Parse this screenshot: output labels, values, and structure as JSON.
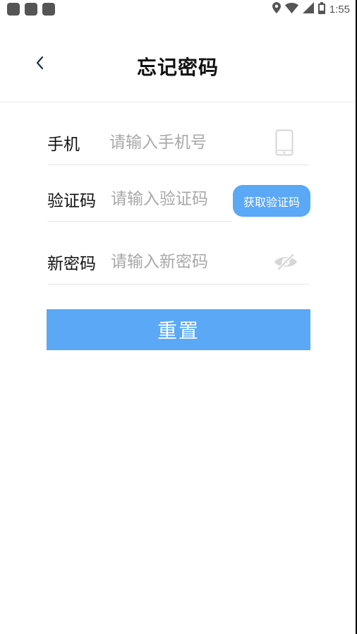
{
  "status_bar": {
    "time": "1:55",
    "icons": [
      "notification-icon",
      "notification-icon",
      "notification-icon",
      "location-icon",
      "wifi-icon",
      "signal-icon",
      "battery-icon"
    ]
  },
  "header": {
    "title": "忘记密码",
    "back_icon": "chevron-left-icon"
  },
  "form": {
    "phone": {
      "label": "手机",
      "placeholder": "请输入手机号",
      "value": "",
      "icon": "phone-icon"
    },
    "code": {
      "label": "验证码",
      "placeholder": "请输入验证码",
      "value": "",
      "button_label": "获取验证码"
    },
    "password": {
      "label": "新密码",
      "placeholder": "请输入新密码",
      "value": "",
      "icon": "eye-off-icon"
    },
    "submit_label": "重置"
  },
  "colors": {
    "accent": "#5aa8f6",
    "placeholder": "#a8a8a8",
    "divider": "#e6e6e6",
    "status": "#555555"
  }
}
